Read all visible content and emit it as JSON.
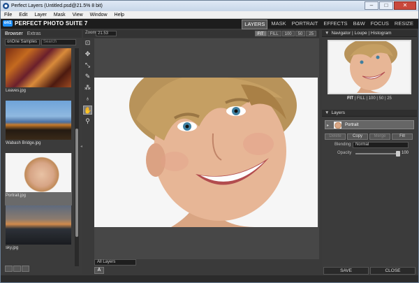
{
  "window": {
    "title": "Perfect Layers (Untitled.psd@21.5% 8 bit)",
    "min": "–",
    "max": "□",
    "close": "✕"
  },
  "menu": [
    "File",
    "Edit",
    "Layer",
    "Mask",
    "View",
    "Window",
    "Help"
  ],
  "app": {
    "logo_mark": "on1",
    "name": "PERFECT PHOTO SUITE 7"
  },
  "modules": [
    {
      "label": "LAYERS",
      "active": true
    },
    {
      "label": "MASK",
      "active": false
    },
    {
      "label": "PORTRAIT",
      "active": false
    },
    {
      "label": "EFFECTS",
      "active": false
    },
    {
      "label": "B&W",
      "active": false
    },
    {
      "label": "FOCUS",
      "active": false
    },
    {
      "label": "RESIZE",
      "active": false
    }
  ],
  "browser": {
    "tabs": [
      "Browser",
      "Extras"
    ],
    "source": "onOne Samples",
    "search_placeholder": "Search",
    "items": [
      {
        "name": "Leaves.jpg",
        "selected": false
      },
      {
        "name": "Wabash Bridge.jpg",
        "selected": false
      },
      {
        "name": "Portrait.jpg",
        "selected": true
      },
      {
        "name": "sky.jpg",
        "selected": false
      }
    ]
  },
  "zoom": {
    "label": "Zoom",
    "value": "21.53",
    "buttons": [
      "FIT",
      "FILL",
      "100",
      "50",
      "25"
    ]
  },
  "canvas": {
    "layer_filter": "All Layers",
    "text_btn": "A"
  },
  "navigator": {
    "tabs": "Navigator | Loupe | Histogram",
    "opts": [
      "FIT",
      "FILL",
      "100",
      "50",
      "25"
    ]
  },
  "layers": {
    "title": "Layers",
    "layer_name": "Portrait",
    "buttons": [
      "Delete",
      "Copy",
      "Merge",
      "Fill"
    ],
    "blending_label": "Blending",
    "blending_value": "Normal",
    "opacity_label": "Opacity",
    "opacity_value": "100"
  },
  "footer": {
    "save": "SAVE",
    "close": "CLOSE"
  }
}
